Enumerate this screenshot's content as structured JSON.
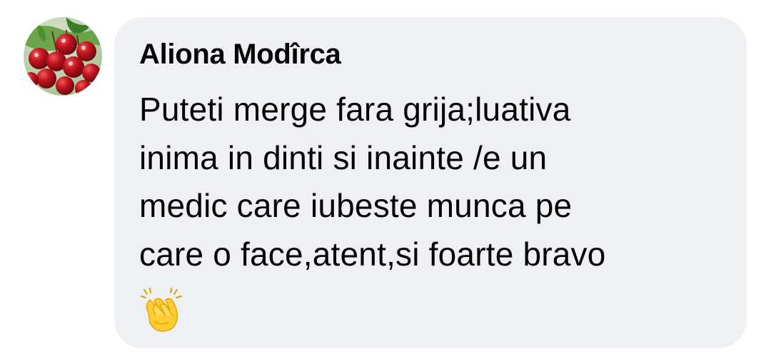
{
  "comment": {
    "author": "Aliona Modîrca",
    "lines": [
      "Puteti merge fara grija;luativa",
      "inima in dinti si inainte /e un",
      "medic care iubeste munca pe",
      "care o face,atent,si foarte bravo"
    ],
    "reaction_icon": "clapping-hands-icon"
  },
  "colors": {
    "bubble": "#eff0f3",
    "text": "#050505",
    "avatar_cherry": "#b3121f",
    "avatar_leaf": "#4e8f2e",
    "emoji_yellow": "#ffcc33"
  }
}
